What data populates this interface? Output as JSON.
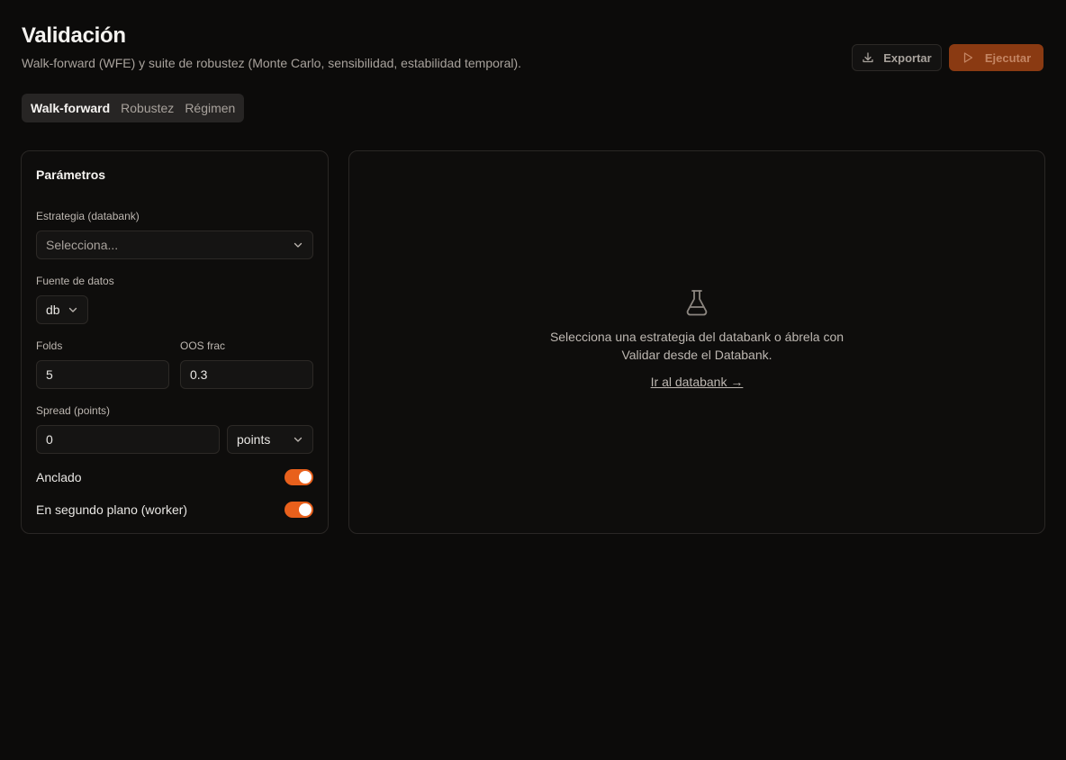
{
  "header": {
    "title": "Validación",
    "subtitle": "Walk-forward (WFE) y suite de robustez (Monte Carlo, sensibilidad, estabilidad temporal)."
  },
  "actions": {
    "export_label": "Exportar",
    "export_icon": "download-icon",
    "run_label": "Ejecutar",
    "run_icon": "play-icon"
  },
  "tabs": [
    {
      "label": "Walk-forward",
      "active": true
    },
    {
      "label": "Robustez",
      "active": false
    },
    {
      "label": "Régimen",
      "active": false
    }
  ],
  "params": {
    "title": "Parámetros",
    "strategy": {
      "label": "Estrategia (databank)",
      "placeholder": "Selecciona..."
    },
    "source": {
      "label": "Fuente de datos",
      "value": "db"
    },
    "folds": {
      "label": "Folds",
      "value": "5"
    },
    "oos": {
      "label": "OOS frac",
      "value": "0.3"
    },
    "spread": {
      "label": "Spread (points)",
      "value": "0",
      "unit": "points"
    },
    "anchored": {
      "label": "Anclado",
      "on": true
    },
    "background": {
      "label": "En segundo plano (worker)",
      "on": true
    }
  },
  "empty": {
    "icon": "flask-icon",
    "message": "Selecciona una estrategia del databank o ábrela con Validar desde el Databank.",
    "link": "Ir al databank →"
  },
  "colors": {
    "background": "#0c0b0a",
    "accent": "#e8601c",
    "run_button": "#8a3a12"
  }
}
